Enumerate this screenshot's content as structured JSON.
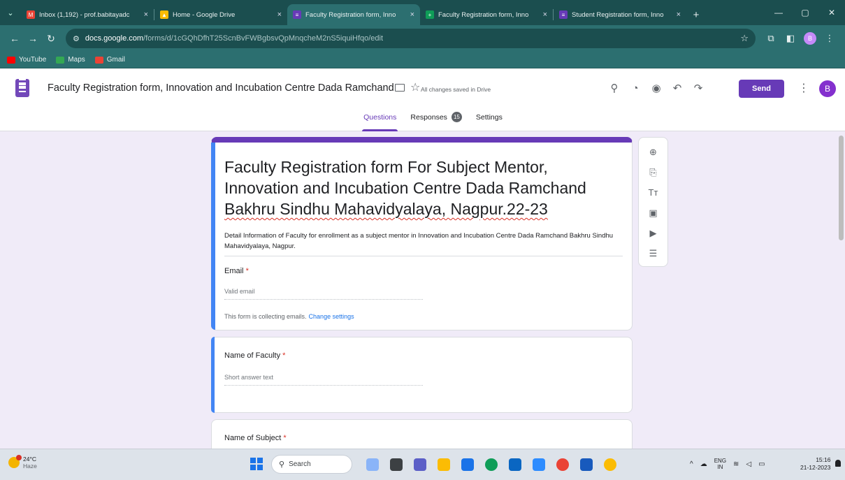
{
  "browser": {
    "tabs": [
      {
        "title": "Inbox (1,192) - prof.babitayadc",
        "favicon": "gmail-icon",
        "color": "#ea4335",
        "active": false
      },
      {
        "title": "Home - Google Drive",
        "favicon": "drive-icon",
        "color": "#fbbc04",
        "active": false
      },
      {
        "title": "Faculty Registration form, Inno",
        "favicon": "forms-icon",
        "color": "#673ab7",
        "active": true
      },
      {
        "title": "Faculty Registration form, Inno",
        "favicon": "sheets-icon",
        "color": "#0f9d58",
        "active": false
      },
      {
        "title": "Student Registration form, Inno",
        "favicon": "forms-icon",
        "color": "#673ab7",
        "active": false
      }
    ],
    "close_glyph": "×",
    "new_tab_glyph": "+",
    "url_host": "docs.google.com",
    "url_path": "/forms/d/1cGQhDfhT25ScnBvFWBgbsvQpMnqcheM2nS5iquiHfqo/edit",
    "bookmarks": [
      {
        "label": "YouTube",
        "color": "#ff0000"
      },
      {
        "label": "Maps",
        "color": "#34a853"
      },
      {
        "label": "Gmail",
        "color": "#ea4335"
      }
    ],
    "profile_initial": "B"
  },
  "forms_header": {
    "doc_title": "Faculty Registration form, Innovation and Incubation Centre Dada Ramchand",
    "saved_status": "All changes saved in Drive",
    "send_label": "Send",
    "avatar_initial": "B",
    "tabs": [
      {
        "label": "Questions",
        "active": true
      },
      {
        "label": "Responses",
        "active": false,
        "badge": "15"
      },
      {
        "label": "Settings",
        "active": false
      }
    ]
  },
  "form": {
    "title_line1": "Faculty Registration form For Subject Mentor,",
    "title_line2": "Innovation and Incubation Centre Dada Ramchand",
    "title_line3": "Bakhru Sindhu Mahavidyalaya, Nagpur.22-23",
    "description": "Detail Information of Faculty for enrollment as a subject mentor in Innovation and Incubation Centre Dada Ramchand Bakhru Sindhu Mahavidyalaya, Nagpur.",
    "email_label": "Email",
    "email_placeholder": "Valid email",
    "collecting_note": "This form is collecting emails.",
    "change_settings": "Change settings",
    "required_marker": "*",
    "questions": [
      {
        "label": "Name of Faculty",
        "placeholder": "Short answer text"
      },
      {
        "label": "Name of Subject",
        "placeholder": ""
      }
    ]
  },
  "taskbar": {
    "temperature": "24°C",
    "weather": "Haze",
    "search_label": "Search",
    "lang_top": "ENG",
    "lang_bottom": "IN",
    "time": "15:16",
    "date": "21-12-2023"
  }
}
